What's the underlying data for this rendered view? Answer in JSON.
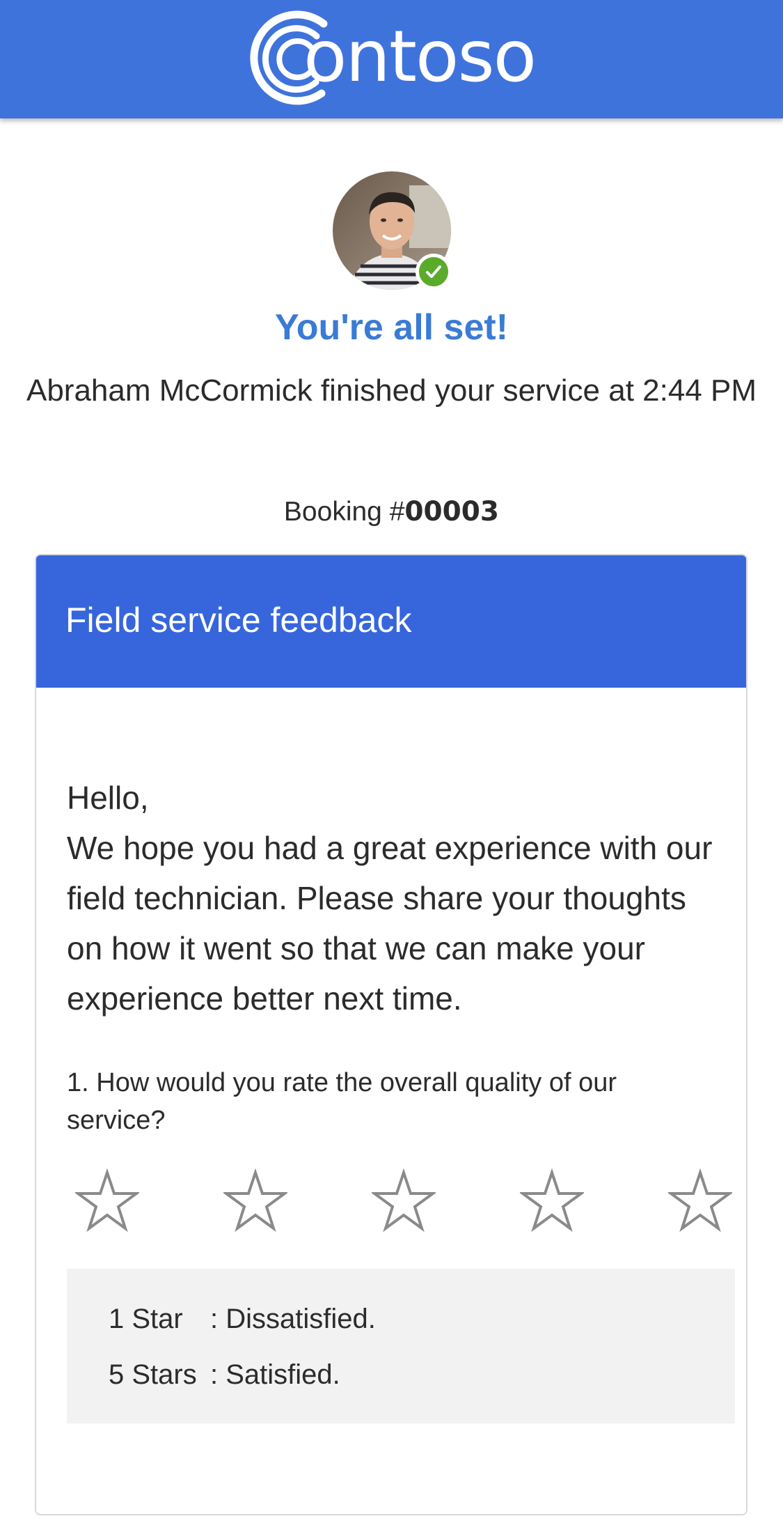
{
  "header": {
    "brand": "ontoso",
    "brand_full": "Contoso",
    "logo_icon": "contoso-c-logo-icon",
    "bg_color": "#3f73dc"
  },
  "technician": {
    "avatar": "technician-avatar",
    "status_icon": "check-circle-icon",
    "status_color": "#5aaa2c"
  },
  "confirmation": {
    "title": "You're all set!",
    "message": "Abraham McCormick finished your service at 2:44 PM",
    "booking_prefix": "Booking #",
    "booking_number": "00003"
  },
  "feedback": {
    "title": "Field service feedback",
    "header_color": "#3766dc",
    "intro_greeting": "Hello,",
    "intro_body": "We hope you had a great experience with our field technician. Please share your thoughts on how it went so that we can make your experience better next time.",
    "question": "1. How would you rate the overall quality of our service?",
    "rating": {
      "max": 5,
      "selected": 0,
      "star_icon": "star-outline-icon"
    },
    "legend": [
      {
        "key": "1 Star",
        "value": ": Dissatisfied."
      },
      {
        "key": "5 Stars",
        "value": ": Satisfied."
      }
    ]
  }
}
